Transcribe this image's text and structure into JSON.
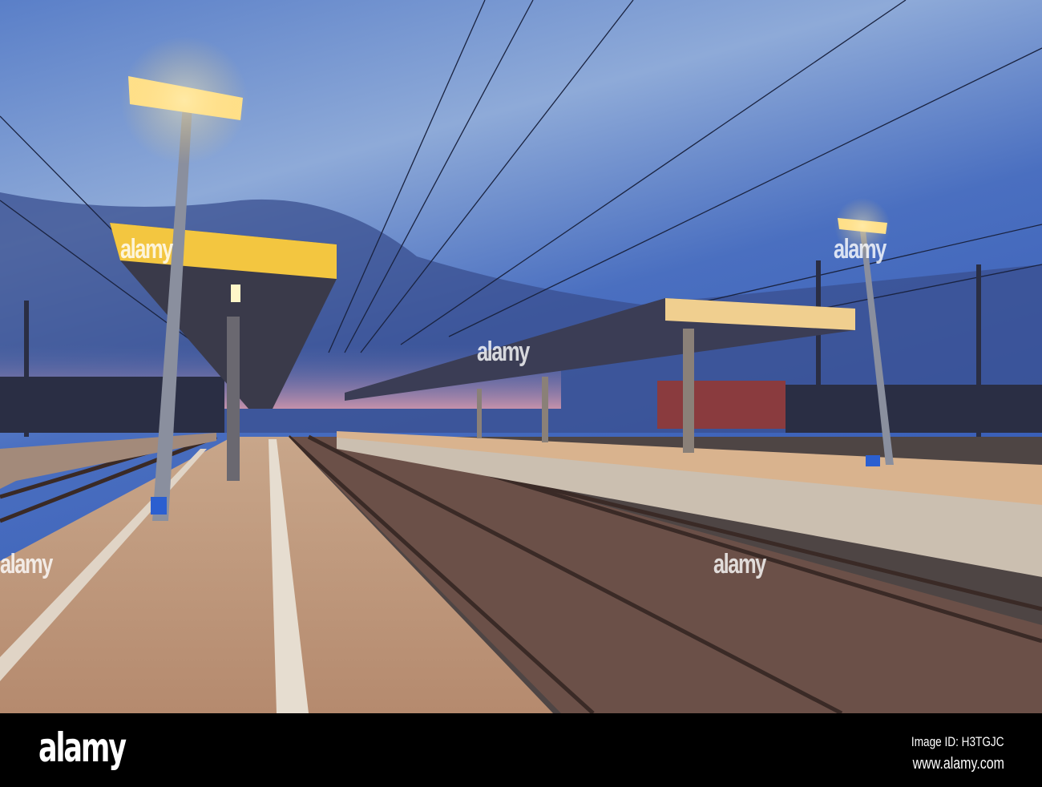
{
  "photo": {
    "subject": "train-station-platforms-at-dusk"
  },
  "watermark": {
    "text": "alamy"
  },
  "footer": {
    "logo": "alamy",
    "image_id": "Image ID: H3TGJC",
    "url": "www.alamy.com"
  },
  "colors": {
    "sky_top": "#3b63bc",
    "sky_horizon": "#e7a0ae",
    "lamp_glow": "#ffd36a",
    "canopy": "#f3c640"
  }
}
